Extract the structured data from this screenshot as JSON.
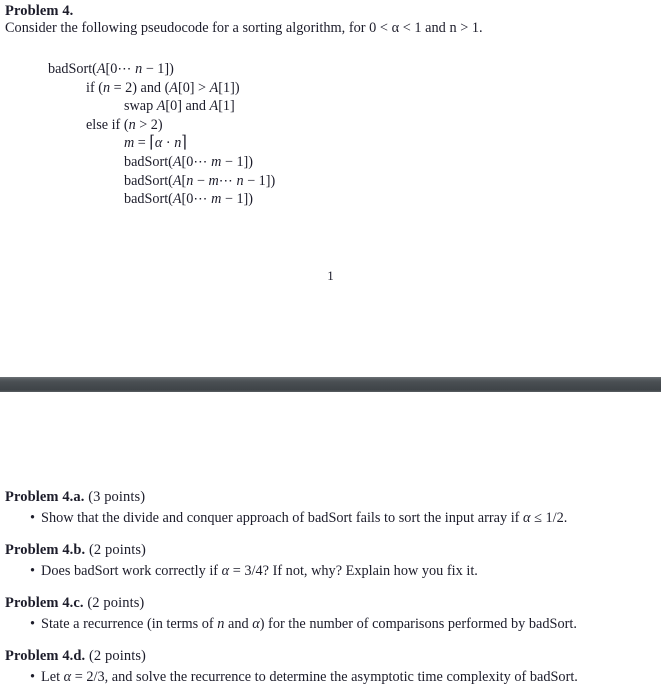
{
  "document": {
    "page_number": "1",
    "text_color": "#1c1c2a",
    "separator_color": "#44494d",
    "background_color": "#ffffff"
  },
  "page_one": {
    "heading": "Problem 4.",
    "intro": "Consider the following pseudocode for a sorting algorithm, for 0 < α < 1 and n > 1.",
    "pseudocode": [
      {
        "indent": 48,
        "text": "badSort(A[0⋯ n − 1])"
      },
      {
        "indent": 86,
        "text": "if (n = 2) and (A[0] > A[1])"
      },
      {
        "indent": 124,
        "text": "swap A[0] and A[1]"
      },
      {
        "indent": 86,
        "text": "else if (n > 2)"
      },
      {
        "indent": 124,
        "text": "m = ⌈α · n⌉"
      },
      {
        "indent": 124,
        "text": "badSort(A[0⋯ m − 1])"
      },
      {
        "indent": 124,
        "text": "badSort(A[n − m⋯ n − 1])"
      },
      {
        "indent": 124,
        "text": "badSort(A[0⋯ m − 1])"
      }
    ]
  },
  "page_two": {
    "parts": [
      {
        "label": "Problem 4.a.",
        "points": "(3 points)",
        "bullet": "Show that the divide and conquer approach of badSort fails to sort the input array if α ≤ 1/2."
      },
      {
        "label": "Problem 4.b.",
        "points": "(2 points)",
        "bullet": "Does badSort work correctly if α = 3/4? If not, why? Explain how you fix it."
      },
      {
        "label": "Problem 4.c.",
        "points": "(2 points)",
        "bullet": "State a recurrence (in terms of n and α) for the number of comparisons performed by badSort."
      },
      {
        "label": "Problem 4.d.",
        "points": "(2 points)",
        "bullet": "Let α = 2/3, and solve the recurrence to determine the asymptotic time complexity of badSort."
      }
    ],
    "bullet_glyph": "•"
  }
}
